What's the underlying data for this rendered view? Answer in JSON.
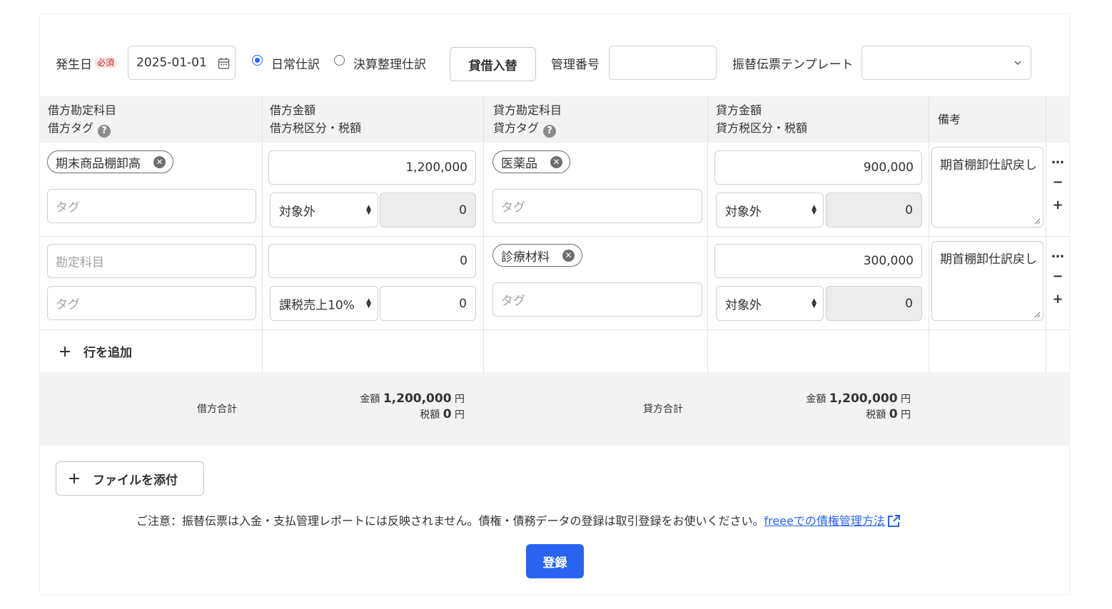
{
  "header": {
    "date_label": "発生日",
    "required_badge": "必須",
    "date_value": "2025-01-01",
    "radio_normal": "日常仕訳",
    "radio_closing": "決算整理仕訳",
    "swap_button": "貸借入替",
    "mgmt_label": "管理番号",
    "mgmt_value": "",
    "template_label": "振替伝票テンプレート",
    "template_value": ""
  },
  "columns": {
    "debit_account": "借方勘定科目",
    "debit_tag": "借方タグ",
    "debit_amount": "借方金額",
    "debit_tax": "借方税区分・税額",
    "credit_account": "貸方勘定科目",
    "credit_tag": "貸方タグ",
    "credit_amount": "貸方金額",
    "credit_tax": "貸方税区分・税額",
    "remarks": "備考"
  },
  "rows": [
    {
      "debit_account": "期末商品棚卸高",
      "debit_tag_placeholder": "タグ",
      "debit_amount": "1,200,000",
      "debit_tax_category": "対象外",
      "debit_tax_amount": "0",
      "credit_account": "医薬品",
      "credit_tag_placeholder": "タグ",
      "credit_amount": "900,000",
      "credit_tax_category": "対象外",
      "credit_tax_amount": "0",
      "remarks": "期首棚卸仕訳戻し"
    },
    {
      "debit_account_placeholder": "勘定科目",
      "debit_tag_placeholder": "タグ",
      "debit_amount": "0",
      "debit_tax_category": "課税売上10%",
      "debit_tax_amount": "0",
      "credit_account": "診療材料",
      "credit_tag_placeholder": "タグ",
      "credit_amount": "300,000",
      "credit_tax_category": "対象外",
      "credit_tax_amount": "0",
      "remarks": "期首棚卸仕訳戻し"
    }
  ],
  "row_controls": {
    "more": "…",
    "remove": "−",
    "add": "+"
  },
  "add_row_label": "行を追加",
  "totals": {
    "debit_label": "借方合計",
    "credit_label": "貸方合計",
    "amount_prefix": "金額",
    "tax_prefix": "税額",
    "unit": "円",
    "debit_amount": "1,200,000",
    "debit_tax": "0",
    "credit_amount": "1,200,000",
    "credit_tax": "0"
  },
  "attach_label": "ファイルを添付",
  "notice_text": "ご注意：振替伝票は入金・支払管理レポートには反映されません。債権・債務データの登録は取引登録をお使いください。",
  "notice_link": "freeeでの債権管理方法",
  "submit_label": "登録",
  "colors": {
    "primary": "#2864f0",
    "header_bg": "#f4f3f3"
  },
  "icons": [
    "calendar-icon",
    "chevron-down-icon",
    "help-icon",
    "clear-icon",
    "plus-icon",
    "external-link-icon"
  ]
}
